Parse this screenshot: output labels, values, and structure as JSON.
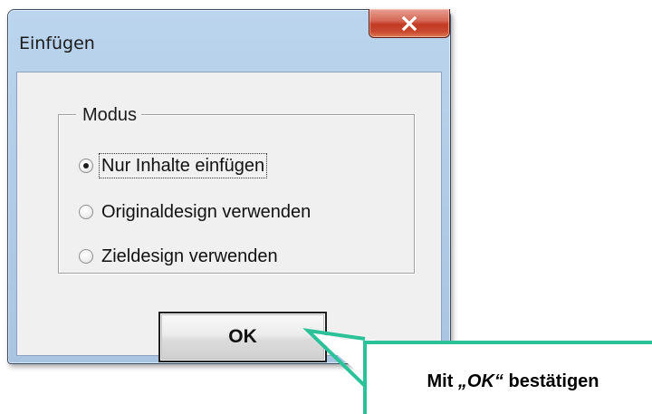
{
  "window": {
    "title": "Einfügen"
  },
  "group": {
    "legend": "Modus",
    "options": [
      {
        "label": "Nur Inhalte einfügen",
        "selected": true
      },
      {
        "label": "Originaldesign verwenden",
        "selected": false
      },
      {
        "label": "Zieldesign verwenden",
        "selected": false
      }
    ]
  },
  "buttons": {
    "ok_label": "OK",
    "close_icon": "close-x-icon"
  },
  "callout": {
    "prefix": "Mit ",
    "emphasis": "„OK“",
    "suffix": " bestätigen",
    "accent_color": "#2bc29a"
  },
  "colors": {
    "close_button": "#c9492f",
    "dialog_background": "#f0f0f0",
    "frame": "#b3cde8"
  }
}
